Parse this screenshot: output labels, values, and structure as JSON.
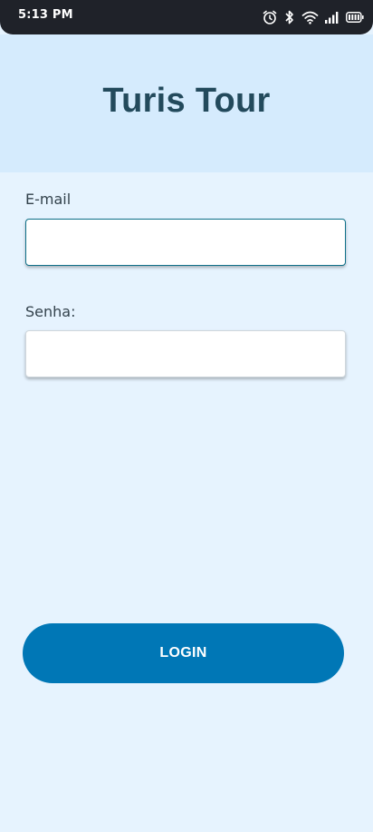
{
  "status_bar": {
    "time": "5:13 PM",
    "icons": [
      "alarm-icon",
      "bluetooth-icon",
      "wifi-icon",
      "signal-icon",
      "battery-icon"
    ]
  },
  "header": {
    "title": "Turis Tour"
  },
  "form": {
    "email_label": "E-mail",
    "email_value": "",
    "password_label": "Senha:",
    "password_value": ""
  },
  "login_button": {
    "label": "LOGIN"
  },
  "colors": {
    "background": "#e6f3fe",
    "header_background": "#d5ebfd",
    "title_color": "#234a5c",
    "button_color": "#0077b6",
    "focused_border": "#0e7089"
  }
}
